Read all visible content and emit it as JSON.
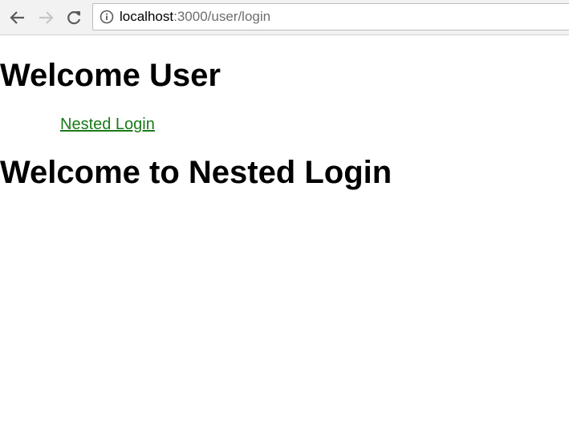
{
  "browser": {
    "url_host": "localhost",
    "url_path": ":3000/user/login",
    "icons": {
      "back": "arrow-left-icon",
      "forward": "arrow-right-icon",
      "reload": "reload-icon",
      "info": "info-icon"
    }
  },
  "page": {
    "heading_user": "Welcome User",
    "nav_link": "Nested Login",
    "heading_nested": "Welcome to Nested Login",
    "link_color": "#1a7a1a"
  }
}
